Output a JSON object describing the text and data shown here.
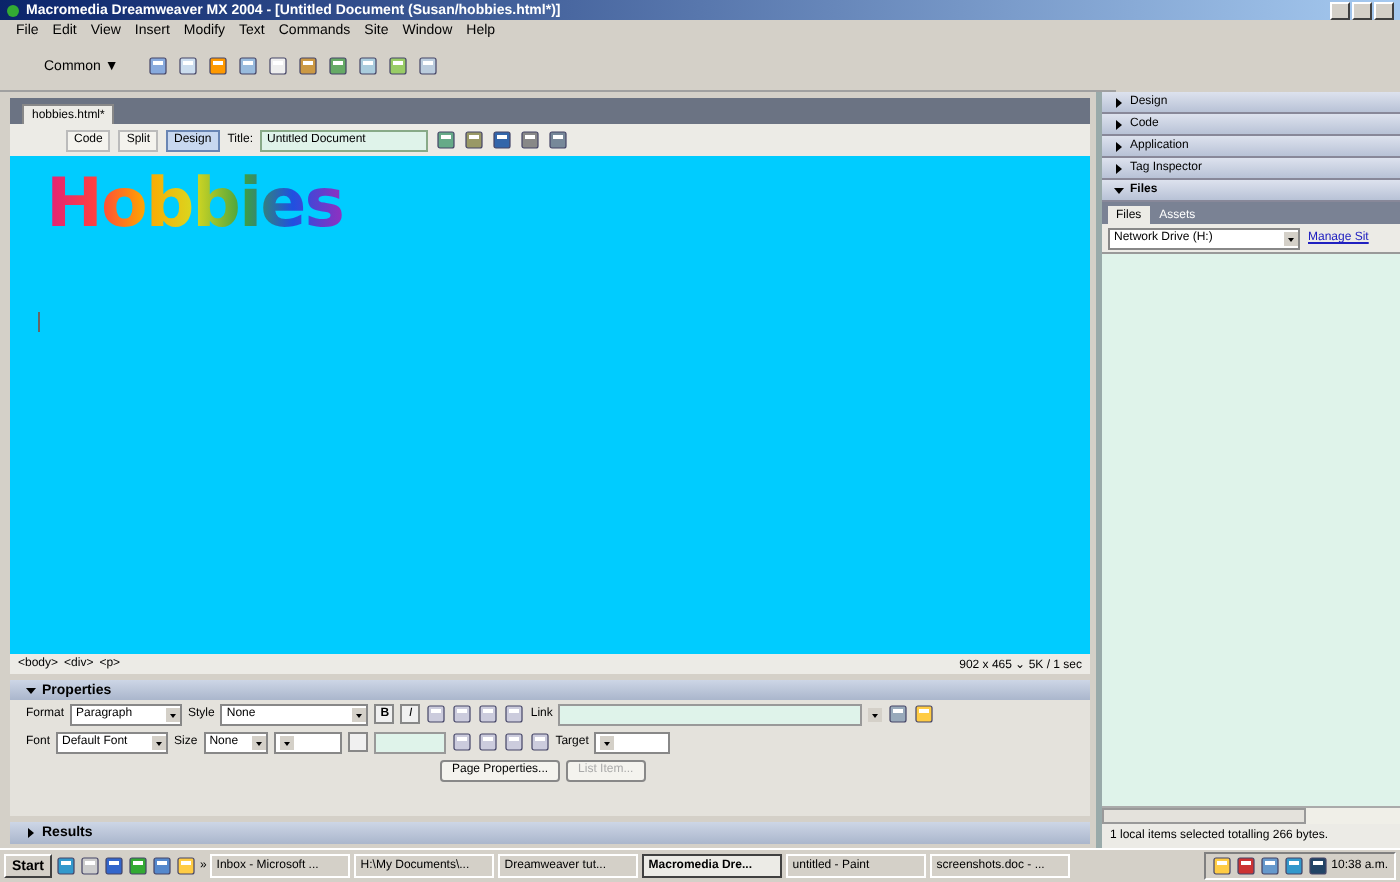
{
  "window": {
    "title": "Macromedia Dreamweaver MX 2004 - [Untitled Document (Susan/hobbies.html*)]"
  },
  "menu": [
    "File",
    "Edit",
    "View",
    "Insert",
    "Modify",
    "Text",
    "Commands",
    "Site",
    "Window",
    "Help"
  ],
  "insert_bar": {
    "category": "Common",
    "caret": "▼"
  },
  "document": {
    "tabs": [
      {
        "label": "hobbies.html*",
        "selected": true
      }
    ],
    "views": [
      {
        "label": "Code",
        "selected": false
      },
      {
        "label": "Split",
        "selected": false
      },
      {
        "label": "Design",
        "selected": true
      }
    ],
    "title_label": "Title:",
    "title_value": "Untitled Document",
    "heading": "Hobbies",
    "tag_path": [
      "<body>",
      "<div>",
      "<p>"
    ],
    "status": "902 x 465 ⌄ 5K / 1 sec"
  },
  "properties": {
    "title": "Properties",
    "expanded": true,
    "format_label": "Format",
    "format": "Paragraph",
    "style_label": "Style",
    "style": "None",
    "bold": "B",
    "italic": "I",
    "link_label": "Link",
    "font_label": "Font",
    "font": "Default Font",
    "size_label": "Size",
    "size": "None",
    "target_label": "Target",
    "buttons": [
      {
        "label": "Page Properties...",
        "disabled": false
      },
      {
        "label": "List Item...",
        "disabled": true
      }
    ]
  },
  "results": {
    "title": "Results",
    "expanded": false
  },
  "panels": [
    {
      "title": "Design",
      "expanded": false
    },
    {
      "title": "Code",
      "expanded": false
    },
    {
      "title": "Application",
      "expanded": false
    },
    {
      "title": "Tag Inspector",
      "expanded": false
    },
    {
      "title": "Files",
      "expanded": true
    }
  ],
  "files": {
    "tabs": [
      {
        "label": "Files",
        "selected": true
      },
      {
        "label": "Assets",
        "selected": false
      }
    ],
    "site": "Network Drive (H:)",
    "link": "Manage Sit",
    "status": "1 local items selected totalling 266 bytes."
  },
  "taskbar": {
    "start": "Start",
    "more": "»",
    "tasks": [
      {
        "label": "Inbox - Microsoft ...",
        "selected": false
      },
      {
        "label": "H:\\My Documents\\...",
        "selected": false
      },
      {
        "label": "Dreamweaver tut...",
        "selected": false
      },
      {
        "label": "Macromedia Dre...",
        "selected": true
      },
      {
        "label": "untitled - Paint",
        "selected": false
      },
      {
        "label": "screenshots.doc - ...",
        "selected": false
      }
    ],
    "clock": "10:38 a.m."
  }
}
